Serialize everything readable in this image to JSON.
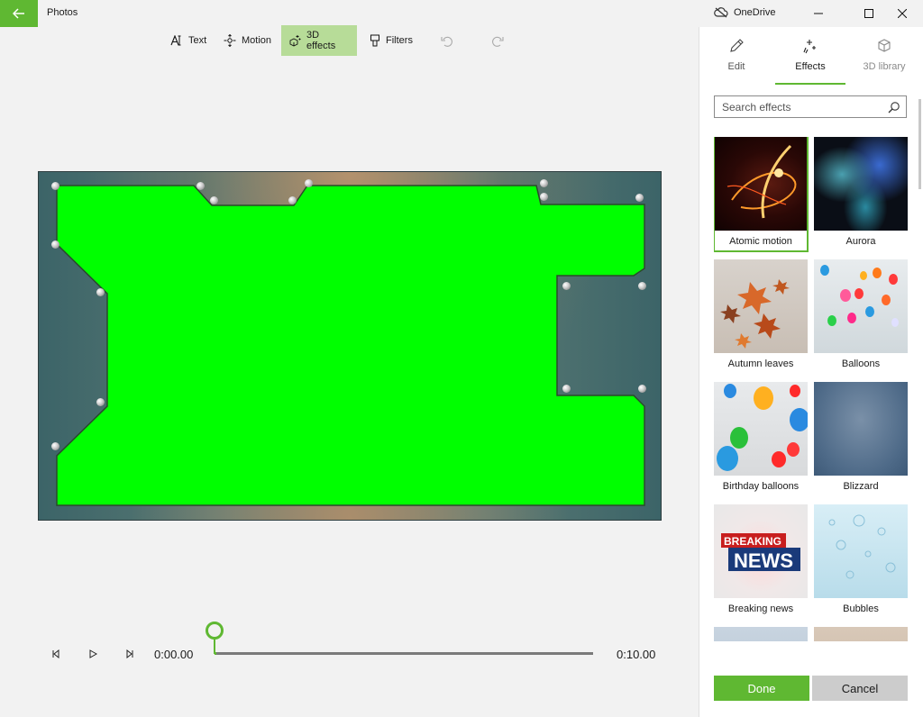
{
  "titlebar": {
    "app_title": "Photos",
    "onedrive_label": "OneDrive"
  },
  "toolbar": {
    "text_label": "Text",
    "motion_label": "Motion",
    "effects_label": "3D effects",
    "filters_label": "Filters"
  },
  "player": {
    "current_time": "0:00.00",
    "total_time": "0:10.00",
    "progress": 0
  },
  "panel": {
    "tabs": [
      {
        "label": "Edit",
        "icon": "pencil-icon"
      },
      {
        "label": "Effects",
        "icon": "sparkle-icon"
      },
      {
        "label": "3D library",
        "icon": "cube-icon"
      }
    ],
    "search_placeholder": "Search effects",
    "effects": [
      {
        "label": "Atomic motion",
        "selected": true
      },
      {
        "label": "Aurora"
      },
      {
        "label": "Autumn leaves"
      },
      {
        "label": "Balloons"
      },
      {
        "label": "Birthday balloons"
      },
      {
        "label": "Blizzard"
      },
      {
        "label": "Breaking news",
        "thumb_text_1": "BREAKING",
        "thumb_text_2": "NEWS"
      },
      {
        "label": "Bubbles"
      }
    ],
    "done_label": "Done",
    "cancel_label": "Cancel"
  },
  "colors": {
    "accent": "#5fb832",
    "chroma_green": "#00ff00"
  }
}
